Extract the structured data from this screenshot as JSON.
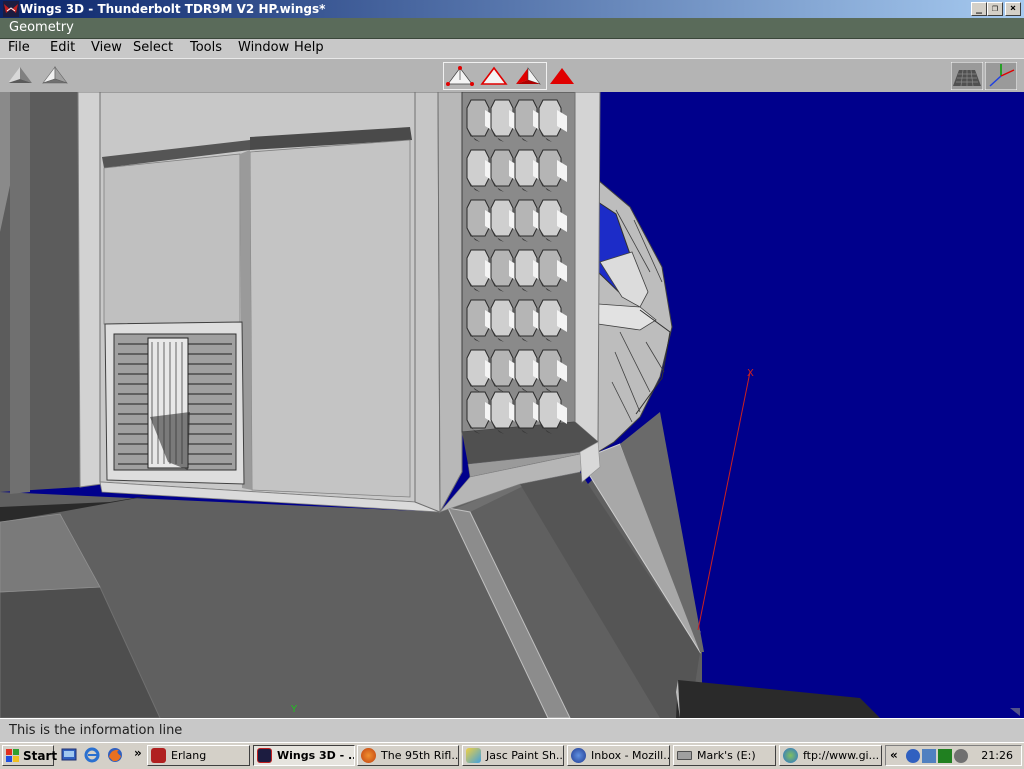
{
  "window": {
    "title": "Wings 3D - Thunderbolt TDR9M V2 HP.wings*",
    "controls": [
      "minimize",
      "maximize",
      "close"
    ]
  },
  "geometry_header": {
    "label": "Geometry"
  },
  "menu": {
    "items": [
      "File",
      "Edit",
      "View",
      "Select",
      "Tools",
      "Window",
      "Help"
    ]
  },
  "toolbar": {
    "left_icons": [
      "smooth-preview-icon",
      "flat-preview-icon"
    ],
    "selection_modes": [
      "vertex-mode-icon",
      "edge-mode-icon",
      "face-mode-icon",
      "body-mode-icon"
    ],
    "right_icons": [
      "ground-grid-icon",
      "axes-icon"
    ]
  },
  "viewport": {
    "axis_labels": {
      "x": "X",
      "y": "Y"
    },
    "colors": {
      "background": "#00008c",
      "mesh_light": "#c8c8c8",
      "mesh_dark": "#5a5a5a",
      "x_axis": "#cc2020",
      "y_axis": "#20c020"
    }
  },
  "info_line": {
    "text": "This is the information line"
  },
  "taskbar": {
    "start_label": "Start",
    "chevron": "»",
    "buttons": [
      {
        "label": "Erlang",
        "icon": "erlang-icon",
        "active": false
      },
      {
        "label": "Wings 3D - ...",
        "icon": "wings3d-icon",
        "active": true
      },
      {
        "label": "The 95th Rifl...",
        "icon": "firefox-icon",
        "active": false
      },
      {
        "label": "Jasc Paint Sh...",
        "icon": "paintshop-icon",
        "active": false
      },
      {
        "label": "Inbox - Mozill...",
        "icon": "thunderbird-icon",
        "active": false
      },
      {
        "label": "Mark's (E:)",
        "icon": "drive-icon",
        "active": false
      },
      {
        "label": "ftp://www.gi...",
        "icon": "ftp-icon",
        "active": false
      }
    ],
    "tray_chevron": "«",
    "clock": "21:26"
  }
}
